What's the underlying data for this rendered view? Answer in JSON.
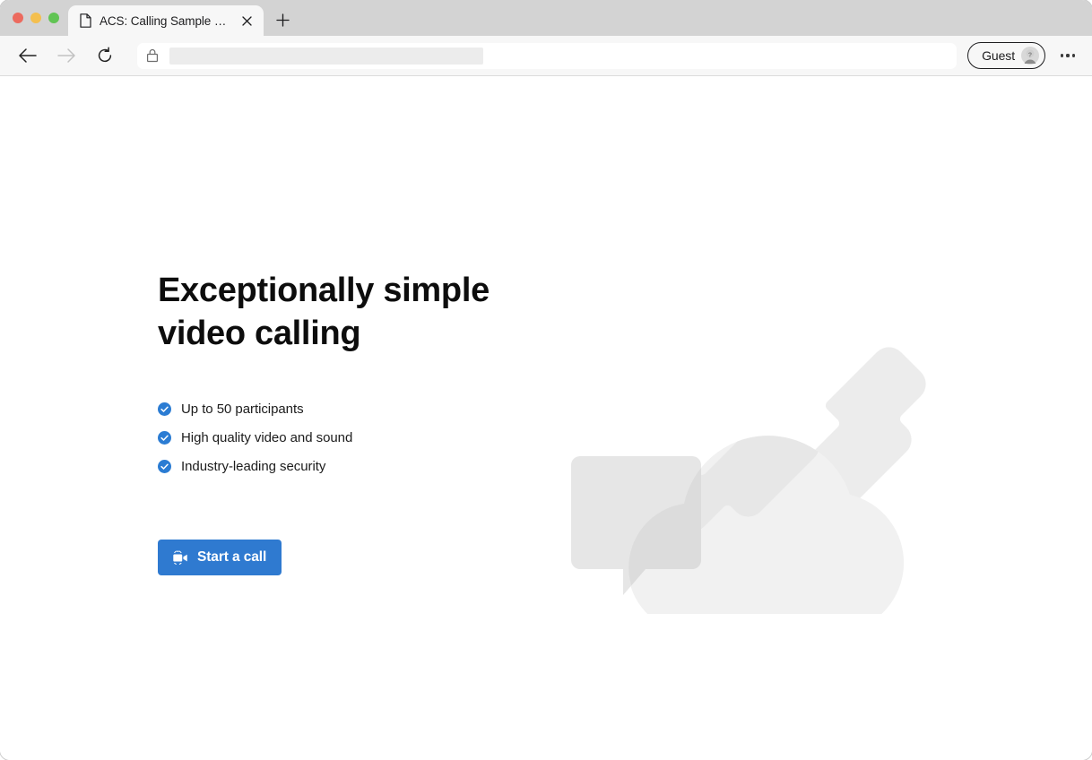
{
  "window": {
    "traffic_lights": [
      {
        "name": "close",
        "color": "#EC6A5E"
      },
      {
        "name": "minimize",
        "color": "#F4BF4F"
      },
      {
        "name": "zoom",
        "color": "#61C454"
      }
    ]
  },
  "tabstrip": {
    "tabs": [
      {
        "title": "ACS: Calling Sample app",
        "favicon": "page-icon",
        "active": true,
        "close_label": "×"
      }
    ],
    "new_tab_label": "+"
  },
  "toolbar": {
    "back_label": "Back",
    "forward_label": "Forward",
    "forward_disabled": true,
    "reload_label": "Reload",
    "address_bar": {
      "lock_icon": "lock-icon",
      "value": "",
      "placeholder": "",
      "redacted": true
    },
    "profile": {
      "label": "Guest",
      "avatar_icon": "guest-avatar-icon"
    },
    "menu_label": "⋯"
  },
  "page": {
    "hero": {
      "title": "Exceptionally simple\nvideo calling",
      "features": [
        {
          "icon": "check-circle-icon",
          "text": "Up to 50 participants"
        },
        {
          "icon": "check-circle-icon",
          "text": "High quality video and sound"
        },
        {
          "icon": "check-circle-icon",
          "text": "Industry-leading security"
        }
      ],
      "cta": {
        "label": "Start a call",
        "icon": "video-camera-icon"
      }
    },
    "illustration": {
      "name": "cloud-phone-chat-illustration",
      "shapes": [
        "cloud",
        "phone-handset",
        "chat-bubble"
      ]
    }
  },
  "colors": {
    "accent_blue": "#2F7AD0",
    "check_blue": "#2B7CD3",
    "chrome_bg": "#F7F7F7",
    "tabstrip_bg": "#D3D3D3",
    "illustration_gray": "#F1F1F1",
    "illustration_gray_dark": "#E3E3E3",
    "text_primary": "#0D0D0D"
  }
}
